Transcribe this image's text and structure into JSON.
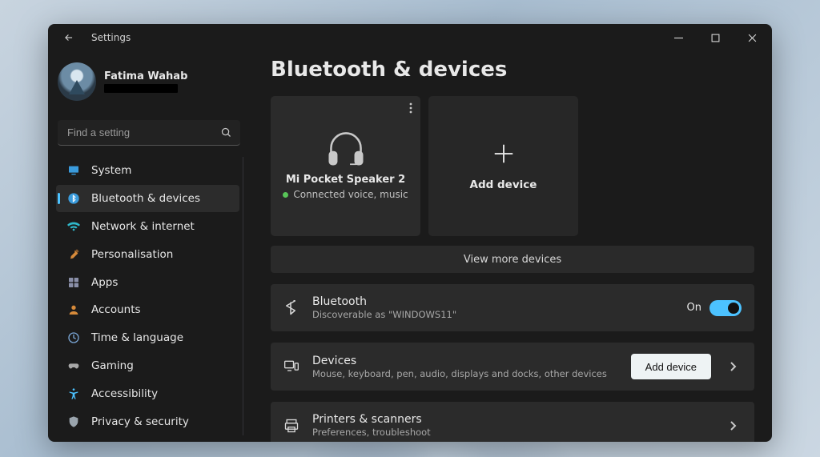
{
  "windowTitle": "Settings",
  "user": {
    "name": "Fatima Wahab"
  },
  "search": {
    "placeholder": "Find a setting"
  },
  "nav": [
    {
      "id": "system",
      "label": "System"
    },
    {
      "id": "bluetooth",
      "label": "Bluetooth & devices"
    },
    {
      "id": "network",
      "label": "Network & internet"
    },
    {
      "id": "personal",
      "label": "Personalisation"
    },
    {
      "id": "apps",
      "label": "Apps"
    },
    {
      "id": "accounts",
      "label": "Accounts"
    },
    {
      "id": "time",
      "label": "Time & language"
    },
    {
      "id": "gaming",
      "label": "Gaming"
    },
    {
      "id": "access",
      "label": "Accessibility"
    },
    {
      "id": "privacy",
      "label": "Privacy & security"
    }
  ],
  "page": {
    "title": "Bluetooth & devices",
    "deviceCard": {
      "name": "Mi Pocket Speaker 2",
      "status": "Connected voice, music"
    },
    "addCard": {
      "label": "Add device"
    },
    "moreBar": "View more devices",
    "bluetoothRow": {
      "title": "Bluetooth",
      "sub": "Discoverable as \"WINDOWS11\"",
      "state": "On"
    },
    "devicesRow": {
      "title": "Devices",
      "sub": "Mouse, keyboard, pen, audio, displays and docks, other devices",
      "button": "Add device"
    },
    "printersRow": {
      "title": "Printers & scanners",
      "sub": "Preferences, troubleshoot"
    }
  }
}
